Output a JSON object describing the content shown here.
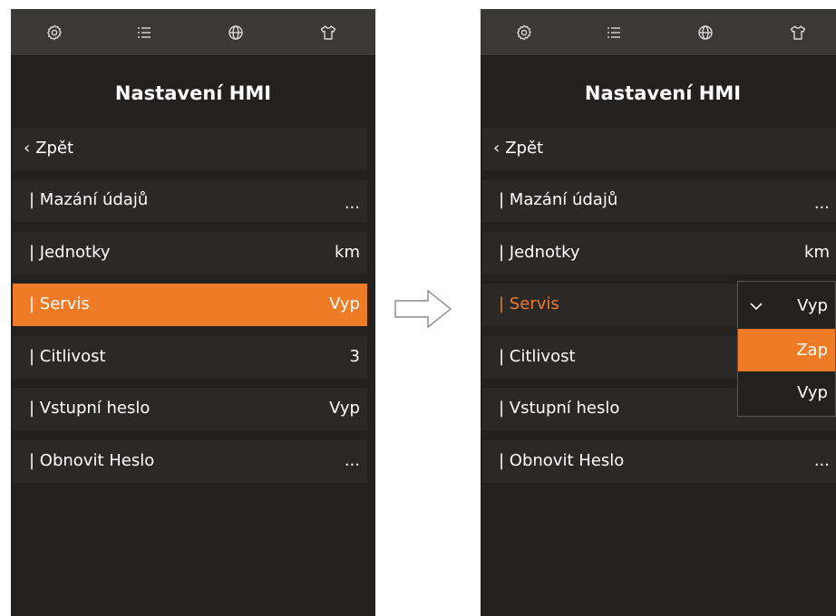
{
  "screens": [
    {
      "title": "Nastavení HMI",
      "back_label": "Zpět",
      "items": [
        {
          "label": "Mazání údajů",
          "value": "..."
        },
        {
          "label": "Jednotky",
          "value": "km"
        },
        {
          "label": "Servis",
          "value": "Vyp"
        },
        {
          "label": "Citlivost",
          "value": "3"
        },
        {
          "label": "Vstupní heslo",
          "value": "Vyp"
        },
        {
          "label": "Obnovit Heslo",
          "value": "..."
        }
      ]
    },
    {
      "title": "Nastavení HMI",
      "back_label": "Zpět",
      "items": [
        {
          "label": "Mazání údajů",
          "value": "..."
        },
        {
          "label": "Jednotky",
          "value": "km"
        },
        {
          "label": "Servis",
          "value": ""
        },
        {
          "label": "Citlivost",
          "value": ""
        },
        {
          "label": "Vstupní heslo",
          "value": ""
        },
        {
          "label": "Obnovit Heslo",
          "value": "..."
        }
      ],
      "dropdown": {
        "current": "Vyp",
        "options": [
          "Zap",
          "Vyp"
        ]
      }
    }
  ],
  "topbar_icons": [
    "gear-icon",
    "list-icon",
    "globe-icon",
    "shirt-icon"
  ],
  "colors": {
    "accent": "#f07b26",
    "panel_bg": "#232020",
    "row_bg": "#2b2828",
    "topbar_bg": "#3b3838",
    "text": "#ffffff"
  }
}
